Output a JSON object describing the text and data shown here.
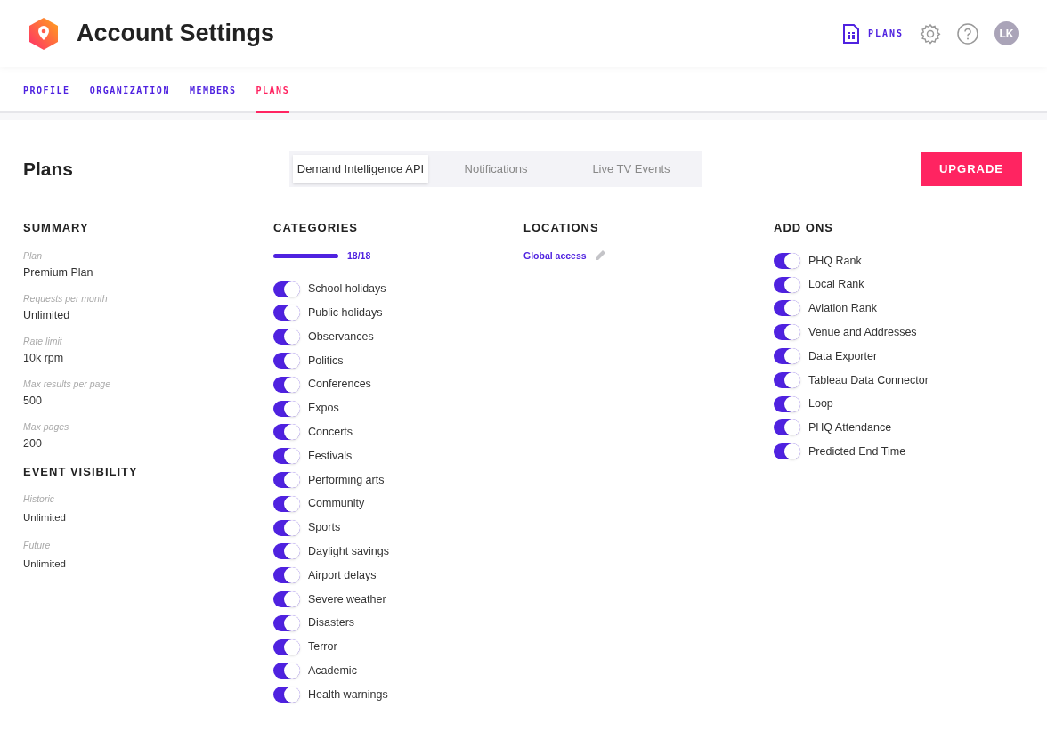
{
  "header": {
    "title": "Account Settings",
    "plans_link": "PLANS",
    "avatar_initials": "LK"
  },
  "nav_tabs": [
    {
      "label": "PROFILE",
      "selected": false
    },
    {
      "label": "ORGANIZATION",
      "selected": false
    },
    {
      "label": "MEMBERS",
      "selected": false
    },
    {
      "label": "PLANS",
      "selected": true
    }
  ],
  "page_title": "Plans",
  "product_tabs": [
    {
      "label": "Demand Intelligence API",
      "selected": true
    },
    {
      "label": "Notifications",
      "selected": false
    },
    {
      "label": "Live TV Events",
      "selected": false
    }
  ],
  "upgrade_button": "UPGRADE",
  "summary": {
    "heading": "SUMMARY",
    "fields": [
      {
        "label": "Plan",
        "value": "Premium Plan"
      },
      {
        "label": "Requests per month",
        "value": "Unlimited"
      },
      {
        "label": "Rate limit",
        "value": "10k rpm"
      },
      {
        "label": "Max results per page",
        "value": "500"
      },
      {
        "label": "Max pages",
        "value": "200"
      }
    ]
  },
  "event_visibility": {
    "heading": "EVENT VISIBILITY",
    "fields": [
      {
        "label": "Historic",
        "value": "Unlimited"
      },
      {
        "label": "Future",
        "value": "Unlimited"
      }
    ]
  },
  "categories": {
    "heading": "CATEGORIES",
    "level": 1,
    "count": "18/18",
    "items": [
      {
        "label": "School holidays",
        "on": true
      },
      {
        "label": "Public holidays",
        "on": true
      },
      {
        "label": "Observances",
        "on": true
      },
      {
        "label": "Politics",
        "on": true
      },
      {
        "label": "Conferences",
        "on": true
      },
      {
        "label": "Expos",
        "on": true
      },
      {
        "label": "Concerts",
        "on": true
      },
      {
        "label": "Festivals",
        "on": true
      },
      {
        "label": "Performing arts",
        "on": true
      },
      {
        "label": "Community",
        "on": true
      },
      {
        "label": "Sports",
        "on": true
      },
      {
        "label": "Daylight savings",
        "on": true
      },
      {
        "label": "Airport delays",
        "on": true
      },
      {
        "label": "Severe weather",
        "on": true
      },
      {
        "label": "Disasters",
        "on": true
      },
      {
        "label": "Terror",
        "on": true
      },
      {
        "label": "Academic",
        "on": true
      },
      {
        "label": "Health warnings",
        "on": true
      }
    ]
  },
  "locations": {
    "heading": "LOCATIONS",
    "value": "Global access"
  },
  "add_ons": {
    "heading": "ADD ONS",
    "items": [
      {
        "label": "PHQ Rank",
        "on": true
      },
      {
        "label": "Local Rank",
        "on": true
      },
      {
        "label": "Aviation Rank",
        "on": true
      },
      {
        "label": "Venue and Addresses",
        "on": true
      },
      {
        "label": "Data Exporter",
        "on": true
      },
      {
        "label": "Tableau Data Connector",
        "on": true
      },
      {
        "label": "Loop",
        "on": true
      },
      {
        "label": "PHQ Attendance",
        "on": true
      },
      {
        "label": "Predicted End Time",
        "on": true
      }
    ]
  }
}
